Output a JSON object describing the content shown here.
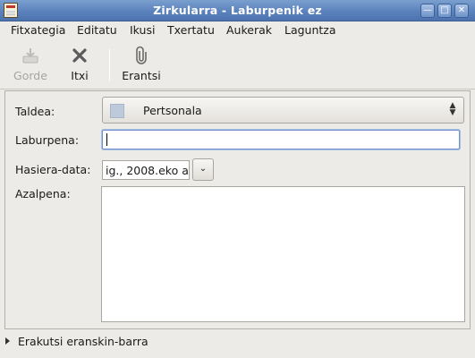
{
  "window": {
    "title": "Zirkularra - Laburpenik ez"
  },
  "menubar": {
    "items": [
      "Fitxategia",
      "Editatu",
      "Ikusi",
      "Txertatu",
      "Aukerak",
      "Laguntza"
    ]
  },
  "toolbar": {
    "save_label": "Gorde",
    "close_label": "Itxi",
    "attach_label": "Erantsi"
  },
  "form": {
    "group_label": "Taldea:",
    "group_value": "Pertsonala",
    "summary_label": "Laburpena:",
    "summary_value": "",
    "start_date_label": "Hasiera-data:",
    "start_date_value": "ig., 2008.eko a",
    "description_label": "Azalpena:",
    "description_value": ""
  },
  "footer": {
    "attachment_bar_label": "Erakutsi eranskin-barra"
  },
  "colors": {
    "titlebar": "#5b82bd",
    "window_bg": "#edebe8",
    "group_swatch": "#bccadc"
  }
}
